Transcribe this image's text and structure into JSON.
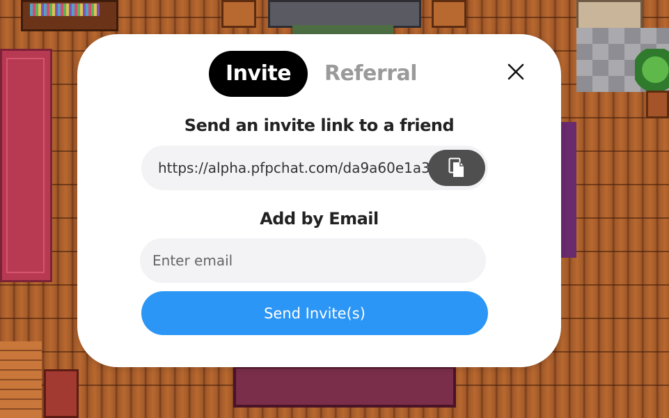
{
  "modal": {
    "tabs": [
      {
        "label": "Invite",
        "active": true
      },
      {
        "label": "Referral",
        "active": false
      }
    ],
    "close_icon": "close-icon",
    "invite_heading": "Send an invite link to a friend",
    "invite_link": "https://alpha.pfpchat.com/da9a60e1a3",
    "copy_icon": "copy-icon",
    "email_heading": "Add by Email",
    "email_input": {
      "value": "",
      "placeholder": "Enter email"
    },
    "send_button": "Send Invite(s)"
  },
  "colors": {
    "tab_active_bg": "#000000",
    "tab_inactive_text": "#9a9a9a",
    "input_bg": "#f3f3f5",
    "copy_button_bg": "#4f4f4f",
    "send_button_bg": "#2b96f5"
  }
}
